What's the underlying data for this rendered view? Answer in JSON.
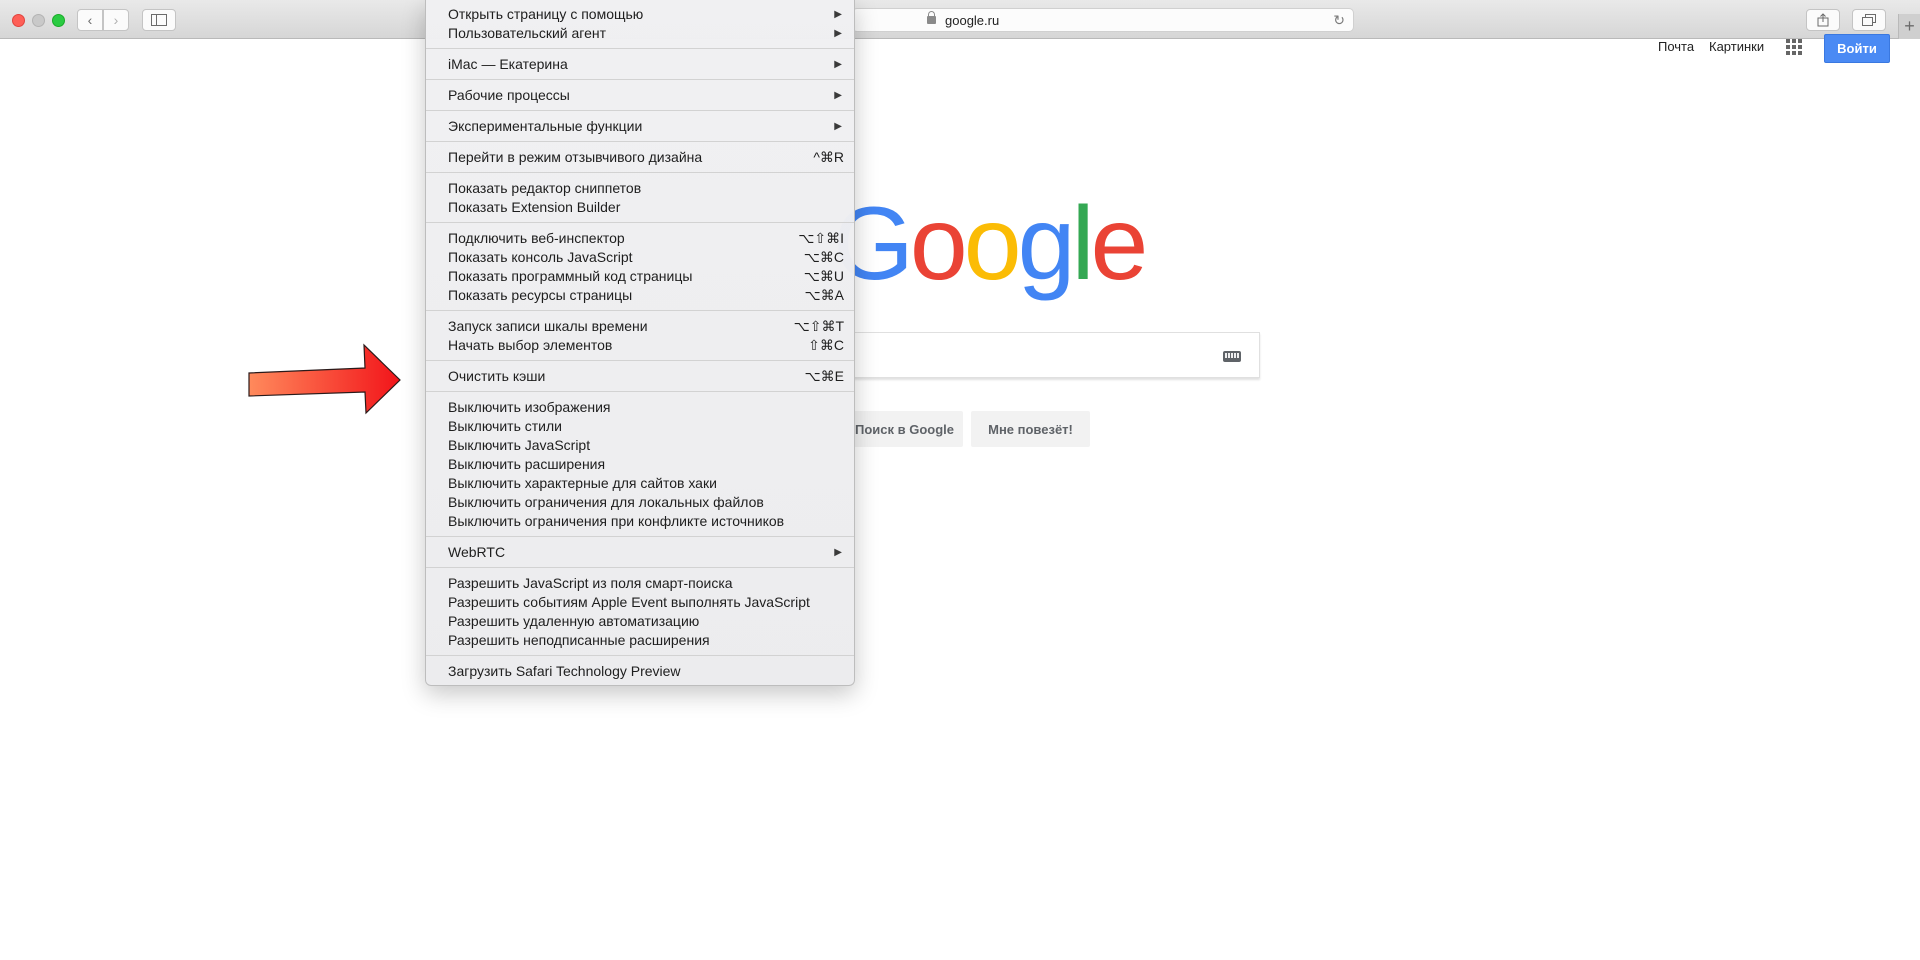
{
  "browser": {
    "url": "google.ru",
    "new_tab_label": "+"
  },
  "google": {
    "mail": "Почта",
    "images": "Картинки",
    "signin": "Войти",
    "logo": [
      "G",
      "o",
      "o",
      "g",
      "l",
      "e"
    ],
    "logo_colors": [
      "#4285f4",
      "#ea4335",
      "#fbbc05",
      "#4285f4",
      "#34a853",
      "#ea4335"
    ],
    "search_button": "Поиск в Google",
    "lucky_button": "Мне повезёт!"
  },
  "menu": {
    "items": [
      {
        "label": "Открыть страницу с помощью",
        "shortcut": "",
        "submenu": true
      },
      {
        "label": "Пользовательский агент",
        "shortcut": "",
        "submenu": true
      },
      {
        "label": "iMac — Екатерина",
        "shortcut": "",
        "submenu": true
      },
      {
        "label": "Рабочие процессы",
        "shortcut": "",
        "submenu": true
      },
      {
        "label": "Экспериментальные функции",
        "shortcut": "",
        "submenu": true
      },
      {
        "label": "Перейти в режим отзывчивого дизайна",
        "shortcut": "^⌘R",
        "submenu": false
      },
      {
        "label": "Показать редактор сниппетов",
        "shortcut": "",
        "submenu": false
      },
      {
        "label": "Показать Extension Builder",
        "shortcut": "",
        "submenu": false
      },
      {
        "label": "Подключить веб-инспектор",
        "shortcut": "⌥⇧⌘I",
        "submenu": false
      },
      {
        "label": "Показать консоль JavaScript",
        "shortcut": "⌥⌘C",
        "submenu": false
      },
      {
        "label": "Показать программный код страницы",
        "shortcut": "⌥⌘U",
        "submenu": false
      },
      {
        "label": "Показать ресурсы страницы",
        "shortcut": "⌥⌘A",
        "submenu": false
      },
      {
        "label": "Запуск записи шкалы времени",
        "shortcut": "⌥⇧⌘T",
        "submenu": false
      },
      {
        "label": "Начать выбор элементов",
        "shortcut": "⇧⌘C",
        "submenu": false
      },
      {
        "label": "Очистить кэши",
        "shortcut": "⌥⌘E",
        "submenu": false
      },
      {
        "label": "Выключить изображения",
        "shortcut": "",
        "submenu": false
      },
      {
        "label": "Выключить стили",
        "shortcut": "",
        "submenu": false
      },
      {
        "label": "Выключить JavaScript",
        "shortcut": "",
        "submenu": false
      },
      {
        "label": "Выключить расширения",
        "shortcut": "",
        "submenu": false
      },
      {
        "label": "Выключить характерные для сайтов хаки",
        "shortcut": "",
        "submenu": false
      },
      {
        "label": "Выключить ограничения для локальных файлов",
        "shortcut": "",
        "submenu": false
      },
      {
        "label": "Выключить ограничения при конфликте источников",
        "shortcut": "",
        "submenu": false
      },
      {
        "label": "WebRTC",
        "shortcut": "",
        "submenu": true
      },
      {
        "label": "Разрешить JavaScript из поля смарт-поиска",
        "shortcut": "",
        "submenu": false
      },
      {
        "label": "Разрешить событиям Apple Event выполнять JavaScript",
        "shortcut": "",
        "submenu": false
      },
      {
        "label": "Разрешить удаленную автоматизацию",
        "shortcut": "",
        "submenu": false
      },
      {
        "label": "Разрешить неподписанные расширения",
        "shortcut": "",
        "submenu": false
      },
      {
        "label": "Загрузить Safari Technology Preview",
        "shortcut": "",
        "submenu": false
      }
    ]
  },
  "annotation_arrow_color": "#f23a20"
}
